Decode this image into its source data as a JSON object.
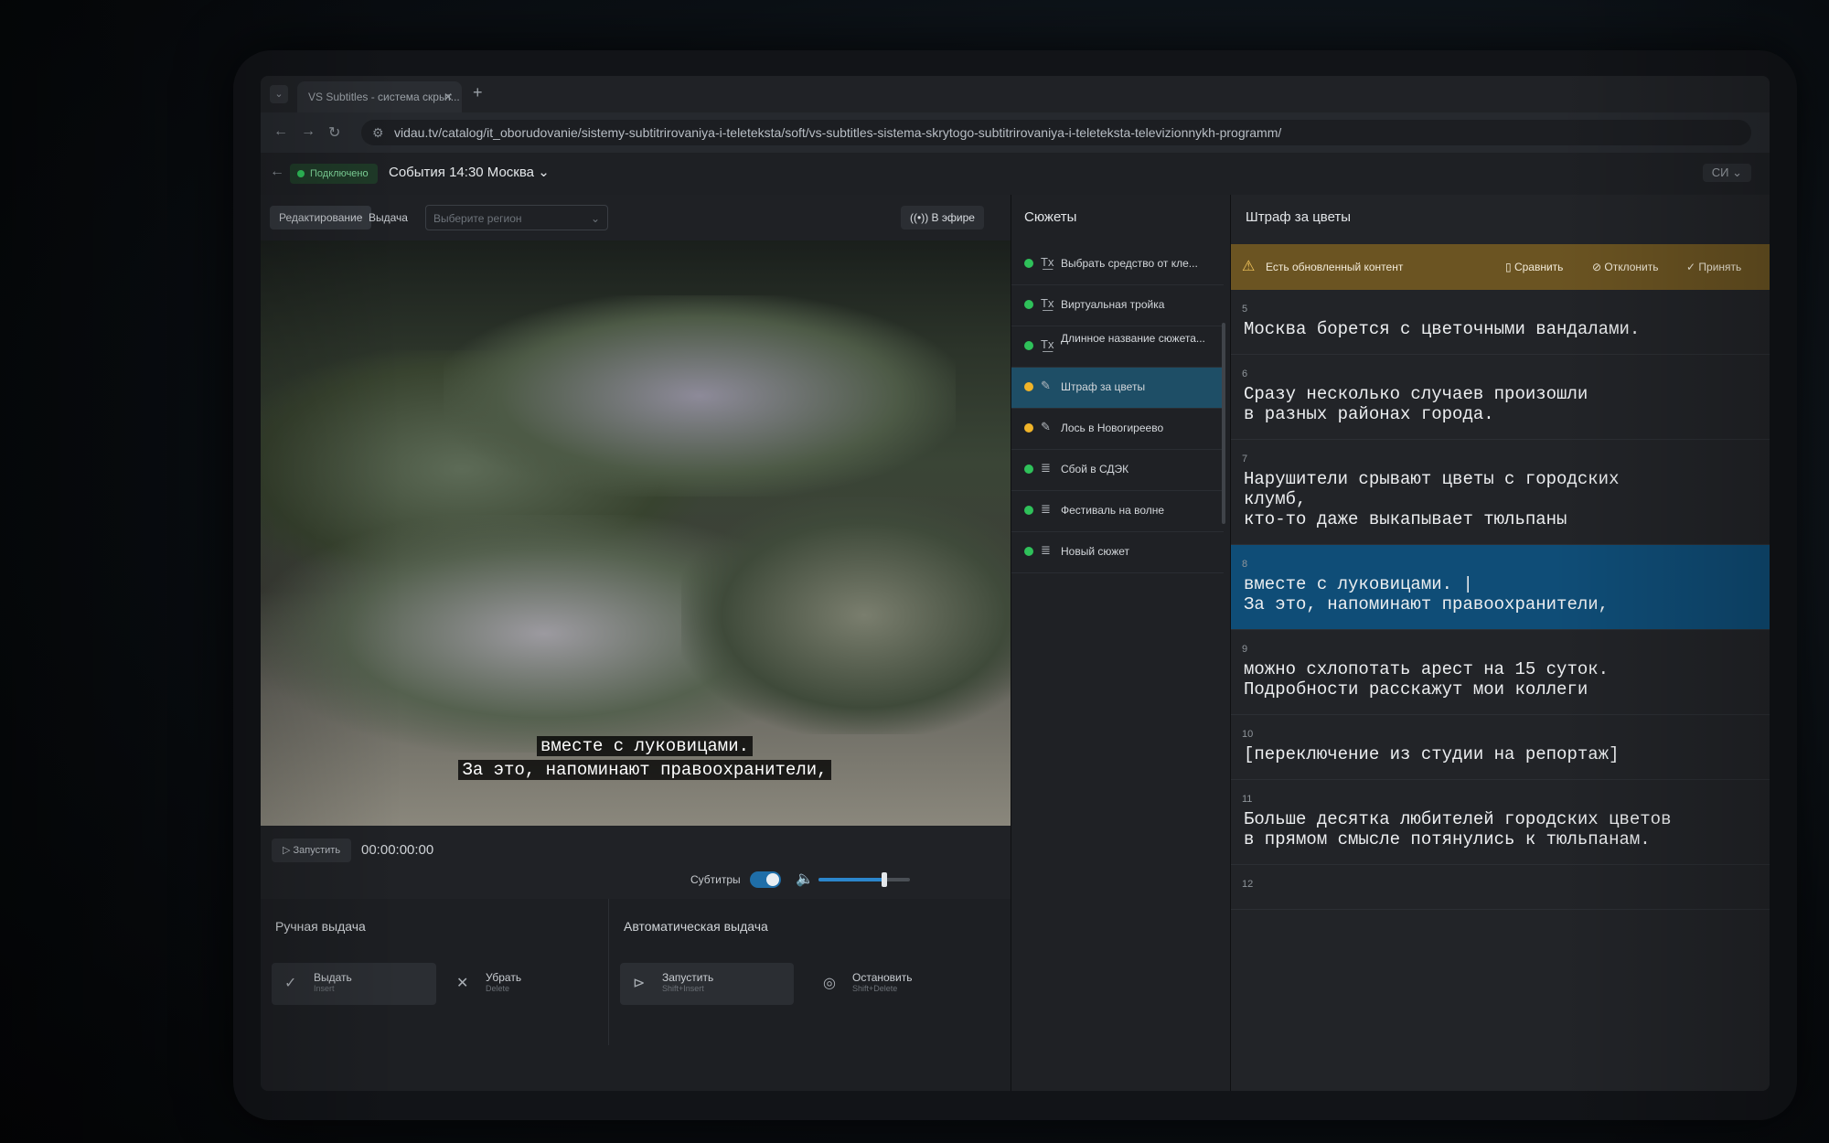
{
  "browser": {
    "tab_title": "VS Subtitles - система скрыт...",
    "url": "vidau.tv/catalog/it_oborudovanie/sistemy-subtitrirovaniya-i-teleteksta/soft/vs-subtitles-sistema-skrytogo-subtitrirovaniya-i-teleteksta-televizionnykh-programm/"
  },
  "header": {
    "status": "Подключено",
    "event_title": "События 14:30 Москва",
    "user": "СИ"
  },
  "toolbar": {
    "mode_edit": "Редактирование",
    "mode_output": "Выдача",
    "region_placeholder": "Выберите регион",
    "on_air": "В эфире"
  },
  "video": {
    "subtitle_line1": "вместе с луковицами.",
    "subtitle_line2": "За это, напоминают правоохранители,"
  },
  "controls": {
    "run": "Запустить",
    "timecode": "00:00:00:00",
    "subtitles_label": "Субтитры",
    "subtitles_on": true,
    "volume": 0.72
  },
  "output": {
    "manual_title": "Ручная выдача",
    "auto_title": "Автоматическая выдача",
    "issue": "Выдать",
    "issue_hint": "Insert",
    "remove": "Убрать",
    "remove_hint": "Delete",
    "start": "Запустить",
    "start_hint": "Shift+Insert",
    "stop": "Остановить",
    "stop_hint": "Shift+Delete"
  },
  "stories": {
    "title": "Сюжеты",
    "items": [
      {
        "label": "Выбрать средство от кле...",
        "status_color": "#2fc15a",
        "icon": "tx-icon"
      },
      {
        "label": "Виртуальная тройка",
        "status_color": "#2fc15a",
        "icon": "tx-icon"
      },
      {
        "label": "Длинное название сюжета...",
        "status_color": "#2fc15a",
        "icon": "tx-icon"
      },
      {
        "label": "Штраф за цветы",
        "status_color": "#f0b429",
        "icon": "edit-list-icon",
        "active": true
      },
      {
        "label": "Лось в Новогиреево",
        "status_color": "#f0b429",
        "icon": "edit-list-icon"
      },
      {
        "label": "Сбой в СДЭК",
        "status_color": "#2fc15a",
        "icon": "list-icon"
      },
      {
        "label": "Фестиваль на волне",
        "status_color": "#2fc15a",
        "icon": "list-icon"
      },
      {
        "label": "Новый сюжет",
        "status_color": "#2fc15a",
        "icon": "list-icon"
      }
    ]
  },
  "editor": {
    "title": "Штраф за цветы",
    "banner": {
      "message": "Есть обновленный контент",
      "compare": "Сравнить",
      "reject": "Отклонить",
      "accept": "Принять"
    },
    "cues": [
      {
        "num": "5",
        "text": "Москва борется с цветочными вандалами."
      },
      {
        "num": "6",
        "text": "Сразу несколько случаев произошли\nв разных районах города."
      },
      {
        "num": "7",
        "text": "Нарушители срывают цветы с городских\nклумб,\nкто-то даже выкапывает тюльпаны"
      },
      {
        "num": "8",
        "text": "вместе с луковицами. |\nЗа это, напоминают правоохранители,",
        "active": true
      },
      {
        "num": "9",
        "text": "можно схлопотать арест на 15 суток.\nПодробности расскажут мои коллеги"
      },
      {
        "num": "10",
        "text": "[переключение из студии на репортаж]"
      },
      {
        "num": "11",
        "text": "Больше десятка любителей городских цветов\nв прямом смысле потянулись к тюльпанам."
      },
      {
        "num": "12",
        "text": ""
      }
    ]
  },
  "colors": {
    "accent": "#1f6ea8",
    "warning_bg": "#6b5422",
    "active_cue": "#0f4d77"
  }
}
